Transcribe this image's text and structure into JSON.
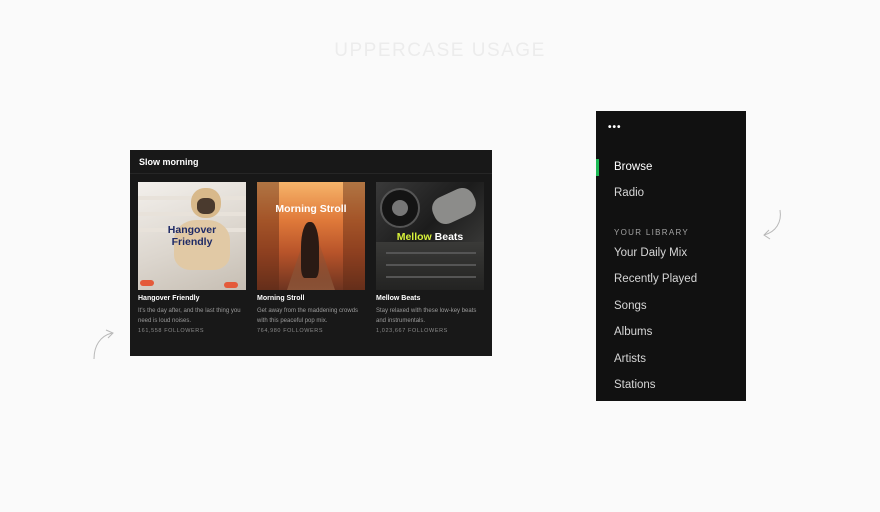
{
  "heading": "UPPERCASE USAGE",
  "playlist_panel": {
    "title": "Slow morning",
    "cards": [
      {
        "cover_text_line1": "Hangover",
        "cover_text_line2": "Friendly",
        "title": "Hangover Friendly",
        "description": "It's the day after, and the last thing you need is loud noises.",
        "followers": "161,558 FOLLOWERS"
      },
      {
        "cover_text": "Morning Stroll",
        "title": "Morning Stroll",
        "description": "Get away from the maddening crowds with this peaceful pop mix.",
        "followers": "764,980 FOLLOWERS"
      },
      {
        "cover_text_a": "Mellow",
        "cover_text_b": "Beats",
        "title": "Mellow Beats",
        "description": "Stay relaxed with these low-key beats and instrumentals.",
        "followers": "1,023,667 FOLLOWERS"
      }
    ]
  },
  "sidebar": {
    "menu_glyph": "•••",
    "nav": [
      {
        "label": "Browse",
        "active": true
      },
      {
        "label": "Radio",
        "active": false
      }
    ],
    "library_label": "YOUR LIBRARY",
    "library": [
      {
        "label": "Your Daily Mix"
      },
      {
        "label": "Recently Played"
      },
      {
        "label": "Songs"
      },
      {
        "label": "Albums"
      },
      {
        "label": "Artists"
      },
      {
        "label": "Stations"
      }
    ]
  },
  "colors": {
    "accent": "#1db954",
    "panel_bg": "#181818",
    "sidebar_bg": "#111111",
    "mellow_highlight": "#d8f23a"
  },
  "icons": [
    "more-dots-icon",
    "curved-arrow-icon"
  ]
}
